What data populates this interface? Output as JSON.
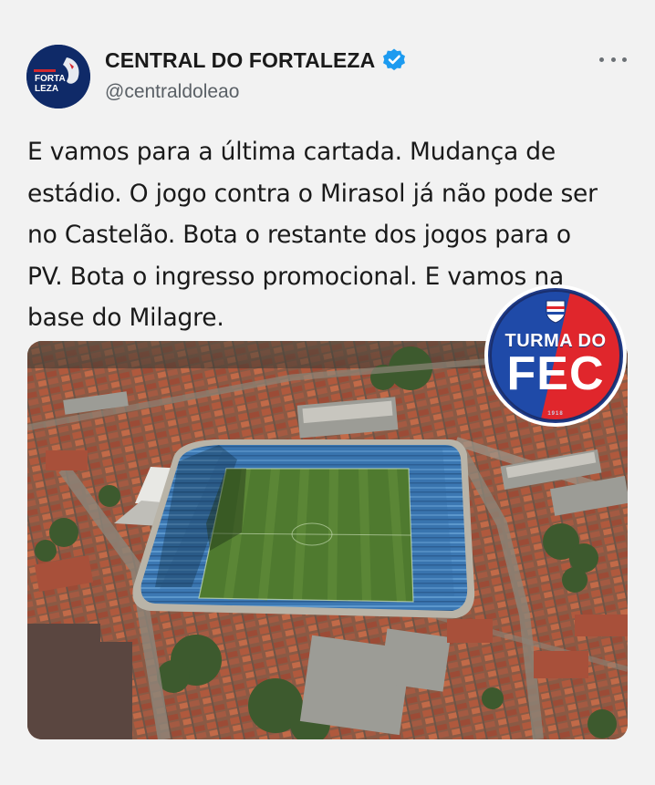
{
  "author": {
    "display_name": "CENTRAL DO FORTALEZA",
    "handle": "@centraldoleao",
    "avatar_text_line1": "FORTA",
    "avatar_text_line2": "LEZA",
    "verified": true
  },
  "tweet": {
    "text_lines": [
      "E vamos para a última cartada. Mudança de",
      "estádio. O jogo contra o Mirasol já não pode ser",
      "no Castelão. Bota o restante dos jogos para o",
      "PV. Bota o ingresso promocional. E vamos na",
      "base do Milagre."
    ]
  },
  "overlay_badge": {
    "top_text": "TURMA DO",
    "main_text": "FEC",
    "year_text": "1918"
  },
  "icons": {
    "verified": "verified-badge-icon",
    "more": "more-options-icon"
  },
  "colors": {
    "background": "#f2f2f2",
    "verified_blue": "#1d9bf0",
    "badge_blue": "#1f4aa8",
    "badge_red": "#e0262c",
    "avatar_navy": "#0f2a68"
  }
}
